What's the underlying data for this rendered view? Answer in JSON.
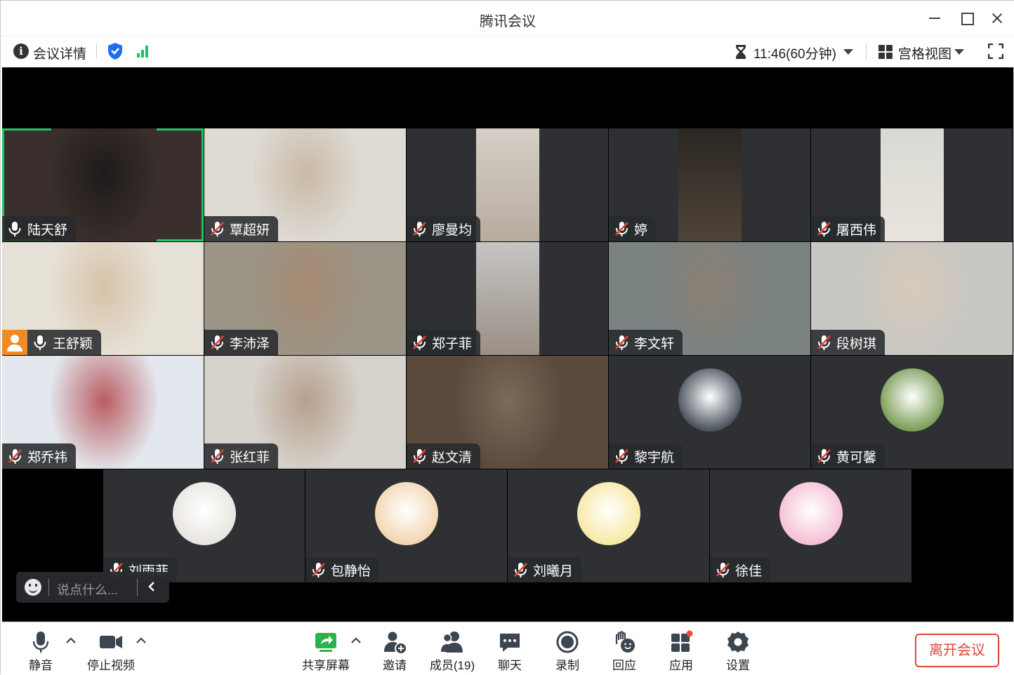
{
  "window": {
    "title": "腾讯会议"
  },
  "infobar": {
    "meeting_details": "会议详情",
    "timer": "11:46(60分钟)",
    "view_mode": "宫格视图"
  },
  "participants": [
    {
      "name": "陆天舒",
      "muted": false,
      "active": true,
      "type": "video",
      "bg": "#3a2f2c",
      "vid": "#1e1b1b"
    },
    {
      "name": "覃超妍",
      "muted": true,
      "type": "video",
      "bg": "#dedbd4",
      "vid": "#c9b9a6"
    },
    {
      "name": "廖曼均",
      "muted": true,
      "type": "narrow",
      "bg": "#d5cfc7",
      "vid": "#b8ab9e"
    },
    {
      "name": "婷",
      "muted": true,
      "type": "narrow",
      "bg": "#2a2622",
      "vid": "#504438"
    },
    {
      "name": "屠西伟",
      "muted": true,
      "type": "narrow",
      "bg": "#d9d9d3",
      "vid": "#e8e4dd"
    },
    {
      "name": "王舒颖",
      "muted": false,
      "host": true,
      "type": "video",
      "bg": "#e6e1d6",
      "vid": "#d7c3a8"
    },
    {
      "name": "李沛泽",
      "muted": true,
      "type": "video",
      "bg": "#9c9486",
      "vid": "#a78a70"
    },
    {
      "name": "郑子菲",
      "muted": true,
      "type": "narrow",
      "bg": "#c6c5c4",
      "vid": "#9a8f86"
    },
    {
      "name": "李文轩",
      "muted": true,
      "type": "video",
      "bg": "#7a8282",
      "vid": "#8c8173"
    },
    {
      "name": "段树琪",
      "muted": true,
      "type": "video",
      "bg": "#c9c7c4",
      "vid": "#d6cbb9"
    },
    {
      "name": "郑乔祎",
      "muted": true,
      "type": "video",
      "bg": "#e3e8ee",
      "vid": "#b95d62"
    },
    {
      "name": "张红菲",
      "muted": true,
      "type": "video",
      "bg": "#d6d3cd",
      "vid": "#b79f8c"
    },
    {
      "name": "赵文清",
      "muted": true,
      "type": "video",
      "bg": "#5a4a3c",
      "vid": "#7c6a5a"
    },
    {
      "name": "黎宇航",
      "muted": true,
      "type": "avatar",
      "av": "#4d5560"
    },
    {
      "name": "黄可馨",
      "muted": true,
      "type": "avatar",
      "av": "#7ea05a"
    },
    {
      "name": "刘雨菲",
      "muted": true,
      "type": "avatar",
      "av": "#e9e6e1"
    },
    {
      "name": "包静怡",
      "muted": true,
      "type": "avatar",
      "av": "#f3d7b3"
    },
    {
      "name": "刘曦月",
      "muted": true,
      "type": "avatar",
      "av": "#f7e9a6"
    },
    {
      "name": "徐佳",
      "muted": true,
      "type": "avatar",
      "av": "#f6c1d6"
    }
  ],
  "chat": {
    "placeholder": "说点什么..."
  },
  "toolbar": {
    "mute": "静音",
    "stop_video": "停止视频",
    "share_screen": "共享屏幕",
    "invite": "邀请",
    "members": "成员(19)",
    "chat": "聊天",
    "record": "录制",
    "react": "回应",
    "apps": "应用",
    "settings": "设置",
    "leave": "离开会议"
  },
  "colors": {
    "active_speaker": "#22c55e",
    "leave": "#e0453a",
    "signal": "#1ec16b",
    "shield": "#1d6ff2",
    "share": "#2bb24c"
  }
}
